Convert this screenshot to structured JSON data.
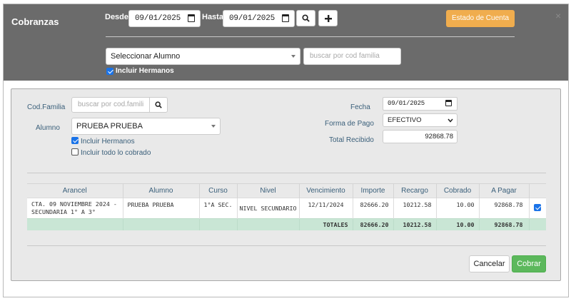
{
  "header": {
    "title": "Cobranzas",
    "desde_label": "Desde",
    "desde_value": "09/01/2025",
    "hasta_label": "Hasta",
    "hasta_value": "09/01/2025",
    "search_icon": "search-icon",
    "add_icon": "plus-icon",
    "estado_label": "Estado de Cuenta",
    "close_glyph": "×",
    "alumno_select": "Seleccionar Alumno",
    "cod_familia_placeholder": "buscar por cod familia",
    "incluir_hermanos_label": "Incluir Hermanos",
    "incluir_hermanos_checked": true
  },
  "form": {
    "cod_familia_label": "Cod.Familia",
    "cod_familia_placeholder": "buscar por cod.famili",
    "alumno_label": "Alumno",
    "alumno_value": "PRUEBA PRUEBA",
    "incluir_hermanos_label": "Incluir Hermanos",
    "incluir_hermanos_checked": true,
    "incluir_cobrado_label": "Incluir todo lo cobrado",
    "incluir_cobrado_checked": false,
    "fecha_label": "Fecha",
    "fecha_value": "09/01/2025",
    "forma_pago_label": "Forma de Pago",
    "forma_pago_value": "EFECTIVO",
    "total_recibido_label": "Total Recibido",
    "total_recibido_value": "92868.78"
  },
  "table": {
    "headers": [
      "Arancel",
      "Alumno",
      "Curso",
      "Nivel",
      "Vencimiento",
      "Importe",
      "Recargo",
      "Cobrado",
      "A Pagar"
    ],
    "rows": [
      {
        "arancel": "CTA. 09 NOVIEMBRE 2024 - SECUNDARIA 1° A 3°",
        "alumno": "PRUEBA PRUEBA",
        "curso": "1°A SEC.",
        "nivel": "NIVEL SECUNDARIO",
        "vencimiento": "12/11/2024",
        "importe": "82666.20",
        "recargo": "10212.58",
        "cobrado": "10.00",
        "a_pagar": "92868.78",
        "selected": true
      }
    ],
    "totals": {
      "label": "TOTALES",
      "importe": "82666.20",
      "recargo": "10212.58",
      "cobrado": "10.00",
      "a_pagar": "92868.78"
    }
  },
  "footer": {
    "cancel_label": "Cancelar",
    "submit_label": "Cobrar"
  }
}
